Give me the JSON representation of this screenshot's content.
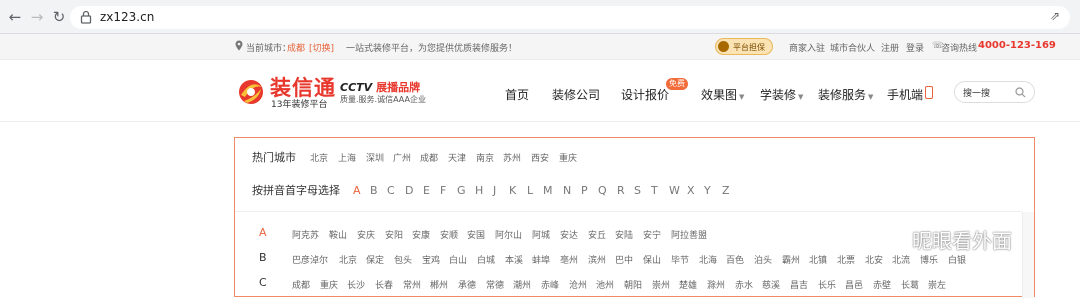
{
  "browser": {
    "url": "zx123.cn"
  },
  "topbar": {
    "city_label": "当前城市：",
    "city": "成都",
    "switch": "[切换]",
    "slogan": "一站式装修平台，为您提供优质装修服务！",
    "guarantee_badge": "平台担保",
    "merchant_join": "商家入驻",
    "city_partner": "城市合伙人",
    "register": "注册",
    "login": "登录",
    "hotline_label": "咨询热线",
    "hotline": "4000-123-169"
  },
  "header": {
    "logo_text": "装信通",
    "logo_sub": "13年装修平台",
    "cctv_text": "CCTV",
    "cctv_brand": "展播品牌",
    "cctv_sub": "质量.服务.诚信AAA企业",
    "nav": {
      "home": "首页",
      "companies": "装修公司",
      "quote": "设计报价",
      "quote_tag": "免费",
      "gallery": "效果图",
      "learn": "学装修",
      "services": "装修服务",
      "mobile": "手机端"
    },
    "search_placeholder": "搜一搜"
  },
  "city_panel": {
    "hot_label": "热门城市",
    "hot_cities": [
      "北京",
      "上海",
      "深圳",
      "广州",
      "成都",
      "天津",
      "南京",
      "苏州",
      "西安",
      "重庆"
    ],
    "pinyin_label": "按拼音首字母选择",
    "letters": [
      "A",
      "B",
      "C",
      "D",
      "E",
      "F",
      "G",
      "H",
      "J",
      "K",
      "L",
      "M",
      "N",
      "P",
      "Q",
      "R",
      "S",
      "T",
      "W",
      "X",
      "Y",
      "Z"
    ],
    "active_letter": "A",
    "groups": [
      {
        "letter": "A",
        "cities": [
          "阿克苏",
          "鞍山",
          "安庆",
          "安阳",
          "安康",
          "安顺",
          "安国",
          "阿尔山",
          "阿城",
          "安达",
          "安丘",
          "安陆",
          "安宁",
          "阿拉善盟"
        ]
      },
      {
        "letter": "B",
        "cities": [
          "巴彦淖尔",
          "北京",
          "保定",
          "包头",
          "宝鸡",
          "白山",
          "白城",
          "本溪",
          "蚌埠",
          "亳州",
          "滨州",
          "巴中",
          "保山",
          "毕节",
          "北海",
          "百色",
          "泊头",
          "霸州",
          "北镇",
          "北票",
          "北安",
          "北流",
          "博乐",
          "白银"
        ]
      },
      {
        "letter": "C",
        "cities": [
          "成都",
          "重庆",
          "长沙",
          "长春",
          "常州",
          "郴州",
          "承德",
          "常德",
          "潮州",
          "赤峰",
          "沧州",
          "池州",
          "朝阳",
          "崇州",
          "楚雄",
          "滁州",
          "赤水",
          "慈溪",
          "昌吉",
          "长乐",
          "昌邑",
          "赤壁",
          "长葛",
          "崇左"
        ]
      }
    ]
  },
  "watermark": "昵眼看外面",
  "colors": {
    "accent": "#e8643c",
    "hotline": "#e8372c",
    "panel_border": "#f08a67"
  }
}
